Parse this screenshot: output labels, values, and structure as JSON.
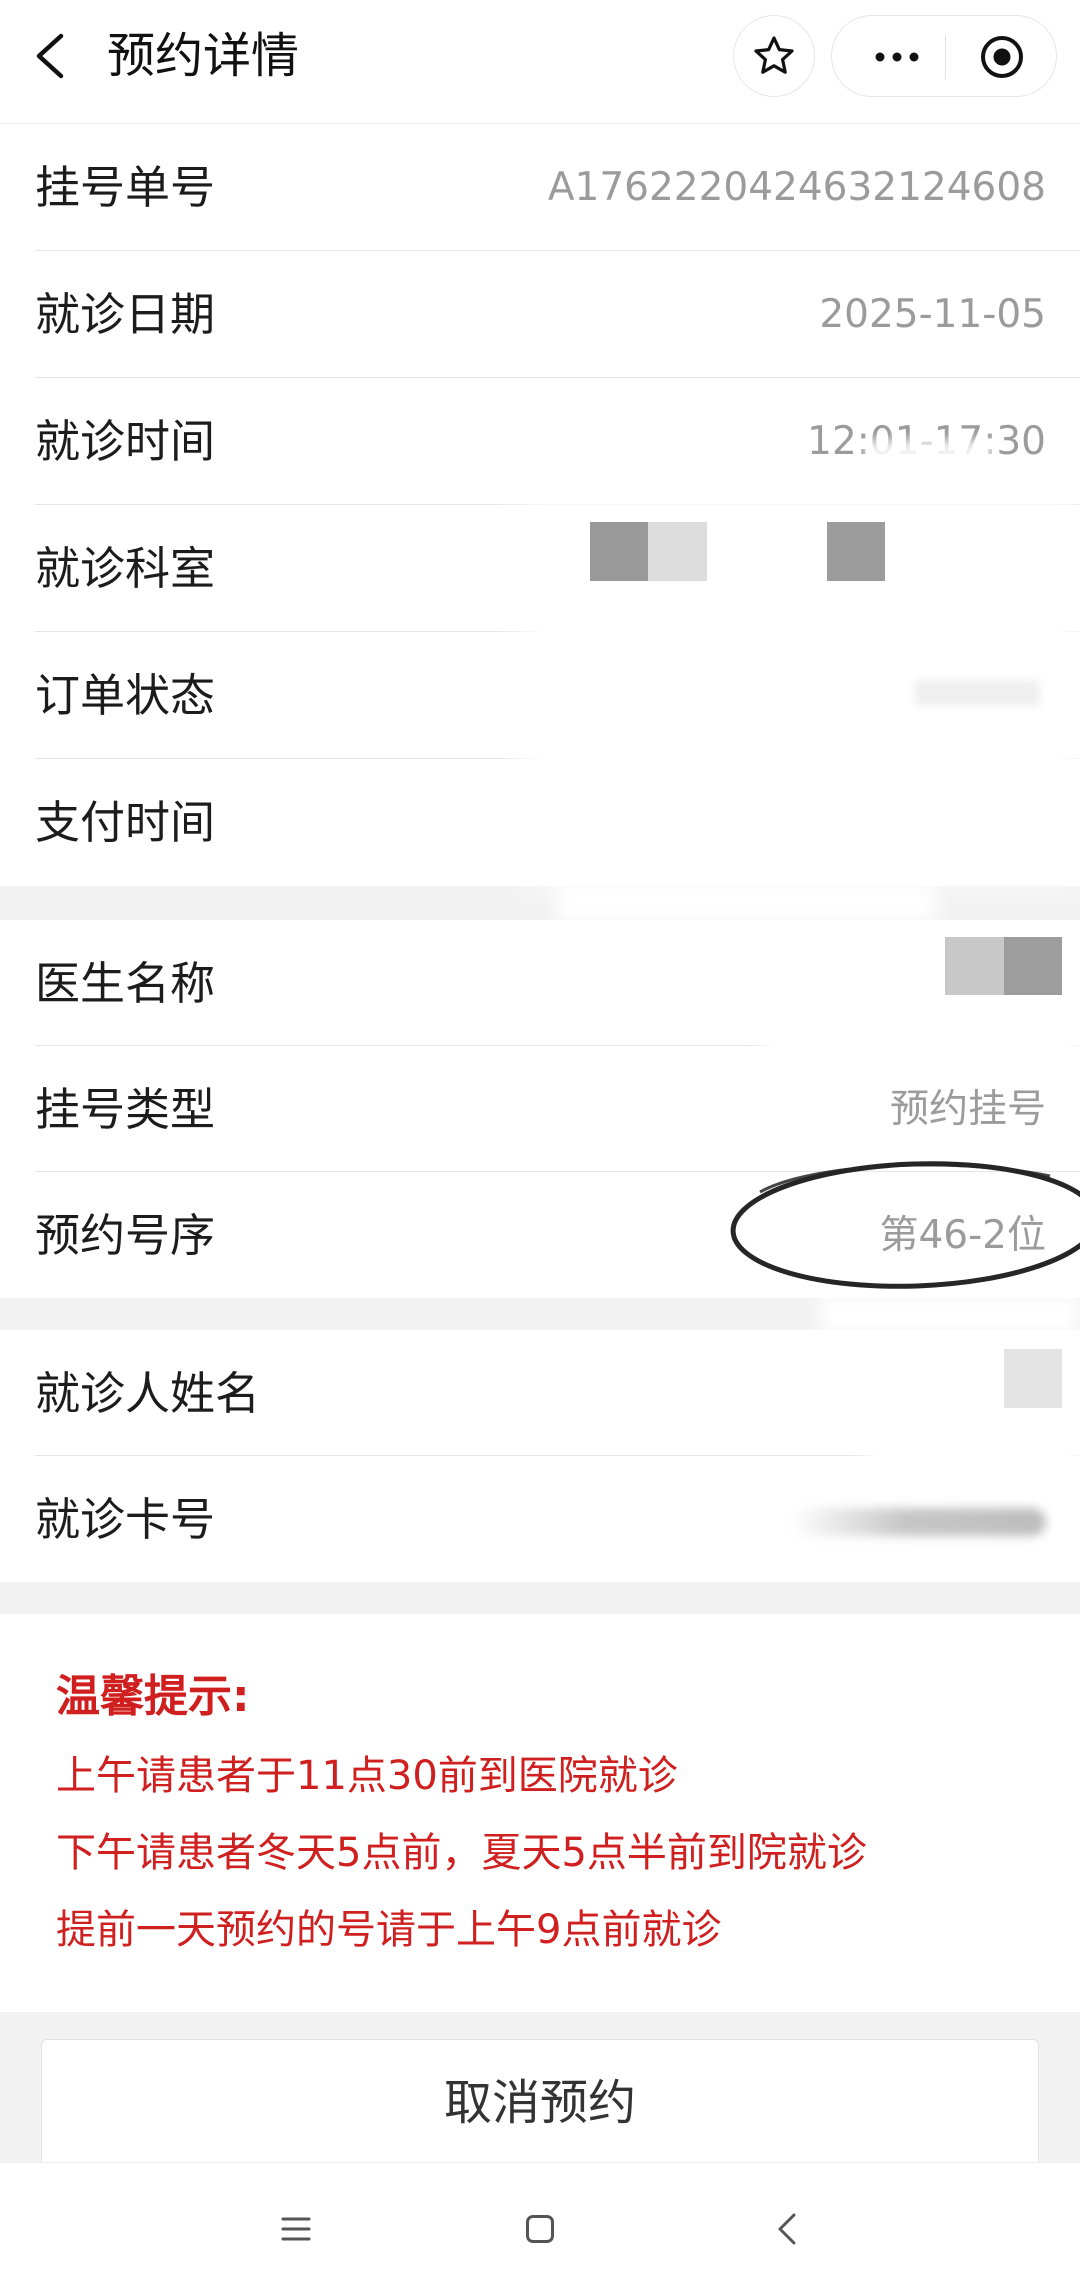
{
  "header": {
    "title": "预约详情",
    "icons": {
      "back": "back-arrow-icon",
      "star": "star-icon",
      "more": "more-dots-icon",
      "close": "target-circle-icon"
    }
  },
  "appointment": {
    "order_no": {
      "label": "挂号单号",
      "value": "A1762220424632124608"
    },
    "visit_date": {
      "label": "就诊日期",
      "value": "2025-11-05"
    },
    "visit_time": {
      "label": "就诊时间",
      "value": "12:01-17:30"
    },
    "department": {
      "label": "就诊科室"
    },
    "order_status": {
      "label": "订单状态"
    },
    "pay_time": {
      "label": "支付时间"
    }
  },
  "doctor": {
    "doctor_name": {
      "label": "医生名称"
    },
    "reg_type": {
      "label": "挂号类型",
      "value": "预约挂号"
    },
    "queue_no": {
      "label": "预约号序",
      "value": "第46-2位"
    }
  },
  "patient": {
    "patient_name": {
      "label": "就诊人姓名"
    },
    "card_no": {
      "label": "就诊卡号"
    }
  },
  "tips": {
    "title": "温馨提示:",
    "lines": [
      "上午请患者于11点30前到医院就诊",
      "下午请患者冬天5点前，夏天5点半前到院就诊",
      "提前一天预约的号请于上午9点前就诊"
    ]
  },
  "actions": {
    "cancel_label": "取消预约"
  },
  "nav": {
    "icons": [
      "menu-icon",
      "home-square-icon",
      "back-chevron-icon"
    ]
  },
  "colors": {
    "accent": "#d01f1f",
    "label": "#1c1c1c",
    "value": "#9b9b9b",
    "bg": "#f2f2f2",
    "line": "#e6e6e6"
  }
}
